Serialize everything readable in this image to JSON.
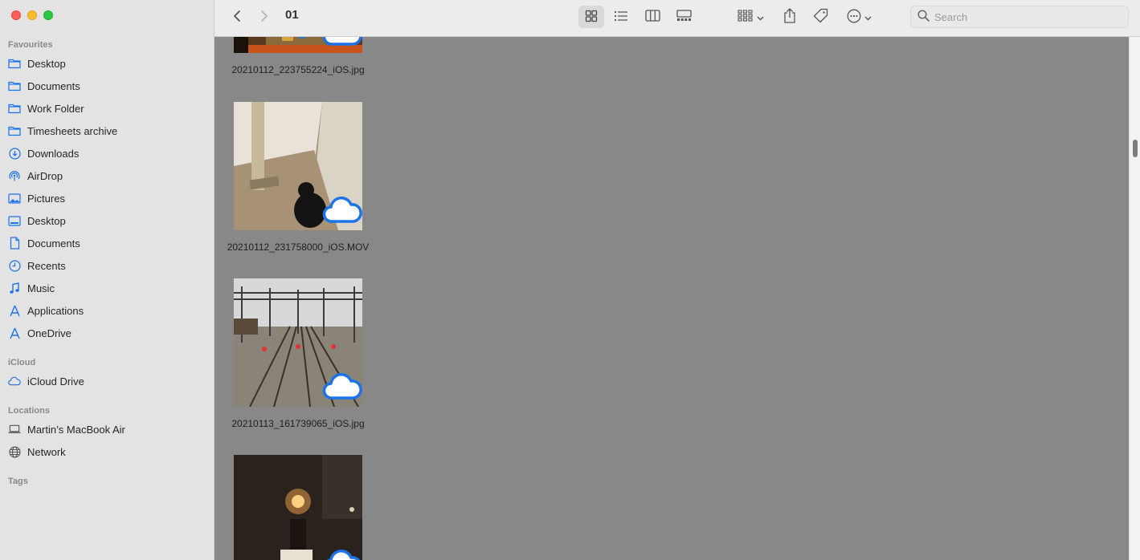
{
  "sidebar": {
    "sections": [
      {
        "title": "Favourites",
        "items": [
          {
            "label": "Desktop",
            "icon": "folder-icon"
          },
          {
            "label": "Documents",
            "icon": "folder-icon"
          },
          {
            "label": "Work Folder",
            "icon": "folder-icon"
          },
          {
            "label": "Timesheets archive",
            "icon": "folder-icon"
          },
          {
            "label": "Downloads",
            "icon": "downloads-icon"
          },
          {
            "label": "AirDrop",
            "icon": "airdrop-icon"
          },
          {
            "label": "Pictures",
            "icon": "pictures-icon"
          },
          {
            "label": "Desktop",
            "icon": "desktop-icon"
          },
          {
            "label": "Documents",
            "icon": "document-icon"
          },
          {
            "label": "Recents",
            "icon": "clock-icon"
          },
          {
            "label": "Music",
            "icon": "music-icon"
          },
          {
            "label": "Applications",
            "icon": "applications-icon"
          },
          {
            "label": "OneDrive",
            "icon": "applications-icon"
          }
        ]
      },
      {
        "title": "iCloud",
        "items": [
          {
            "label": "iCloud Drive",
            "icon": "cloud-icon"
          }
        ]
      },
      {
        "title": "Locations",
        "items": [
          {
            "label": "Martin’s MacBook Air",
            "icon": "laptop-icon"
          },
          {
            "label": "Network",
            "icon": "globe-icon"
          }
        ]
      },
      {
        "title": "Tags",
        "items": []
      }
    ]
  },
  "toolbar": {
    "folder_title": "01",
    "search_placeholder": "Search"
  },
  "files": [
    {
      "name": "20210112_223755224_iOS.jpg",
      "thumb": "orange-photo"
    },
    {
      "name": "20210112_231758000_iOS.MOV",
      "thumb": "cat-hallway"
    },
    {
      "name": "20210113_161739065_iOS.jpg",
      "thumb": "railway-tracks"
    },
    {
      "name": "",
      "thumb": "night-signal"
    }
  ],
  "colors": {
    "accent": "#1a73e8",
    "sidebar_bg": "#e3e3e3",
    "content_bg": "#888888"
  }
}
